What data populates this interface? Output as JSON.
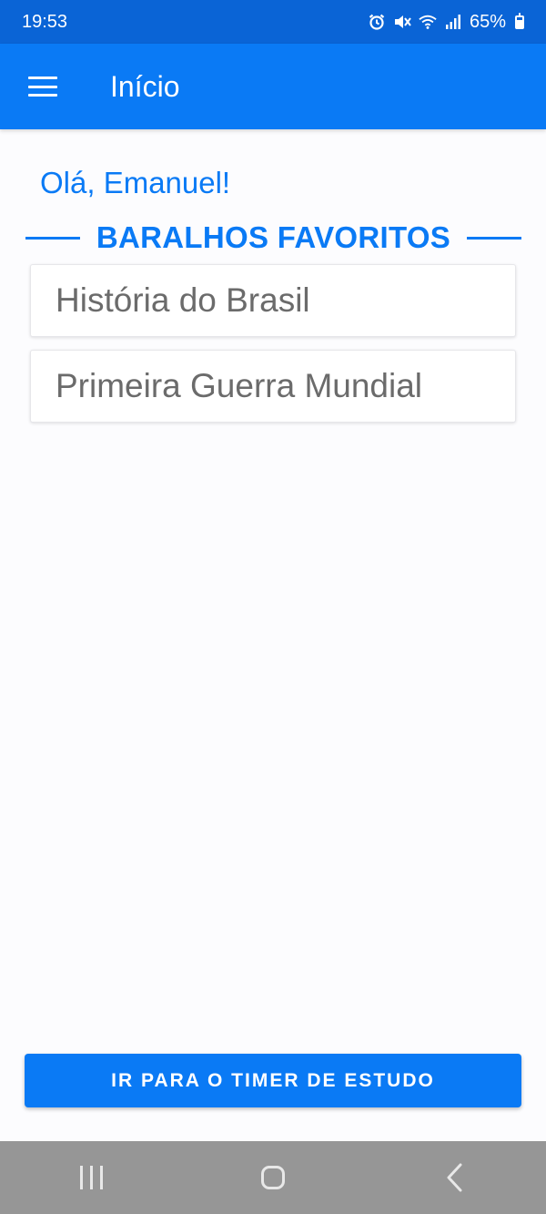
{
  "status_bar": {
    "time": "19:53",
    "battery_percent": "65%",
    "icons": [
      "alarm-icon",
      "mute-icon",
      "wifi-icon",
      "signal-icon",
      "battery-icon"
    ]
  },
  "app_bar": {
    "title": "Início",
    "menu_icon": "hamburger-menu-icon"
  },
  "greeting": "Olá, Emanuel!",
  "favorites": {
    "section_title": "BARALHOS FAVORITOS",
    "decks": [
      {
        "name": "História do Brasil"
      },
      {
        "name": "Primeira Guerra Mundial"
      }
    ]
  },
  "actions": {
    "timer_button_label": "IR PARA O TIMER DE ESTUDO"
  },
  "nav_bar": {
    "icons": [
      "recents-icon",
      "home-icon",
      "back-icon"
    ]
  },
  "colors": {
    "primary": "#0a7af5",
    "status_bar": "#0a64d6",
    "nav_bar": "#969696",
    "deck_text": "#6b6b6b"
  }
}
